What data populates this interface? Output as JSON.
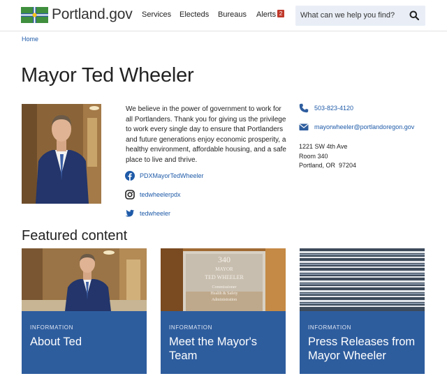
{
  "header": {
    "logo_text": "Portland.gov",
    "nav": [
      "Services",
      "Electeds",
      "Bureaus",
      "Alerts"
    ],
    "alerts_count": "2",
    "search_placeholder": "What can we help you find?"
  },
  "breadcrumb": {
    "home": "Home"
  },
  "page": {
    "title": "Mayor Ted Wheeler"
  },
  "bio": {
    "text": "We believe in the power of government to work for all Portlanders. Thank you for giving us the privilege to work every single day to ensure that Portlanders and future generations enjoy economic prosperity, a healthy environment, affordable housing, and a safe place to live and thrive."
  },
  "social": {
    "facebook": "PDXMayorTedWheeler",
    "instagram": "tedwheelerpdx",
    "twitter": "tedwheeler"
  },
  "contact": {
    "phone": "503-823-4120",
    "email": "mayorwheeler@portlandoregon.gov",
    "address_line1": "1221 SW 4th Ave",
    "address_line2": "Room 340",
    "address_line3": "Portland, OR  97204"
  },
  "featured": {
    "heading": "Featured content",
    "cards": [
      {
        "tag": "INFORMATION",
        "title": "About Ted"
      },
      {
        "tag": "INFORMATION",
        "title": "Meet the Mayor's Team"
      },
      {
        "tag": "INFORMATION",
        "title": "Press Releases from Mayor Wheeler"
      }
    ],
    "door_text": [
      "340",
      "MAYOR",
      "TED WHEELER",
      "Commissioner",
      "Health & Safety",
      "Administration"
    ]
  },
  "colors": {
    "link": "#1e5aa8",
    "card_blue": "#2e5d9e",
    "logo_green": "#3f8f3e",
    "logo_blue": "#2e5d9e",
    "alert_red": "#c0392b"
  },
  "icons": {
    "search": "magnifier-icon",
    "phone": "phone-icon",
    "email": "envelope-icon",
    "facebook": "facebook-icon",
    "instagram": "instagram-icon",
    "twitter": "twitter-icon"
  }
}
